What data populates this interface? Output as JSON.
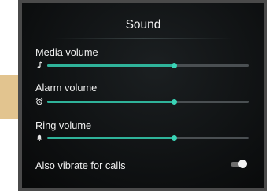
{
  "screen": {
    "title": "Sound"
  },
  "rows": [
    {
      "label": "Media volume",
      "icon": "music-note-icon",
      "level": 0.63
    },
    {
      "label": "Alarm volume",
      "icon": "alarm-clock-icon",
      "level": 0.63
    },
    {
      "label": "Ring volume",
      "icon": "bell-icon",
      "level": 0.63
    }
  ],
  "vibrate": {
    "label": "Also vibrate for calls",
    "enabled": false
  },
  "colors": {
    "accent": "#3ad4b6",
    "track": "#4a4f52",
    "background": "#0d0f10"
  }
}
